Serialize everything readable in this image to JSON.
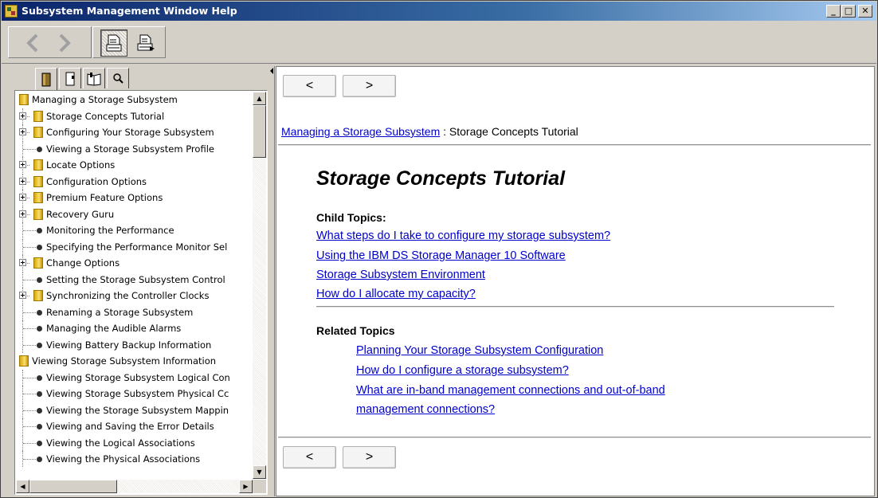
{
  "window": {
    "title": "Subsystem Management Window Help",
    "min_glyph": "_",
    "max_glyph": "□",
    "close_glyph": "✕"
  },
  "toolbar": {
    "back_icon": "back-arrow-icon",
    "forward_icon": "forward-arrow-icon",
    "hide_icon": "hide-pane-icon",
    "print_icon": "print-icon"
  },
  "tabs": [
    {
      "icon": "contents-book-icon"
    },
    {
      "icon": "index-icon"
    },
    {
      "icon": "bookmark-book-icon"
    },
    {
      "icon": "search-magnifier-icon"
    }
  ],
  "tree": [
    {
      "label": "Managing a Storage Subsystem",
      "kind": "folder",
      "level": 0
    },
    {
      "label": "Storage Concepts Tutorial",
      "kind": "folder",
      "level": 1,
      "expander": true
    },
    {
      "label": "Configuring Your Storage Subsystem",
      "kind": "folder",
      "level": 1,
      "expander": true
    },
    {
      "label": "Viewing a Storage Subsystem Profile",
      "kind": "page",
      "level": 1
    },
    {
      "label": "Locate Options",
      "kind": "folder",
      "level": 1,
      "expander": true
    },
    {
      "label": "Configuration Options",
      "kind": "folder",
      "level": 1,
      "expander": true
    },
    {
      "label": "Premium Feature Options",
      "kind": "folder",
      "level": 1,
      "expander": true
    },
    {
      "label": "Recovery Guru",
      "kind": "folder",
      "level": 1,
      "expander": true
    },
    {
      "label": "Monitoring the Performance",
      "kind": "page",
      "level": 1
    },
    {
      "label": "Specifying the Performance Monitor Sel",
      "kind": "page",
      "level": 1
    },
    {
      "label": "Change Options",
      "kind": "folder",
      "level": 1,
      "expander": true
    },
    {
      "label": "Setting the Storage Subsystem Control",
      "kind": "page",
      "level": 1
    },
    {
      "label": "Synchronizing the Controller Clocks",
      "kind": "folder",
      "level": 1,
      "expander": true
    },
    {
      "label": "Renaming a Storage Subsystem",
      "kind": "page",
      "level": 1
    },
    {
      "label": "Managing the Audible Alarms",
      "kind": "page",
      "level": 1
    },
    {
      "label": "Viewing Battery Backup Information",
      "kind": "page",
      "level": 1
    },
    {
      "label": "Viewing Storage Subsystem Information",
      "kind": "folder",
      "level": 0
    },
    {
      "label": "Viewing Storage Subsystem Logical Con",
      "kind": "page",
      "level": 1
    },
    {
      "label": "Viewing Storage Subsystem Physical Cc",
      "kind": "page",
      "level": 1
    },
    {
      "label": "Viewing the Storage Subsystem Mappin",
      "kind": "page",
      "level": 1
    },
    {
      "label": "Viewing and Saving the Error Details",
      "kind": "page",
      "level": 1
    },
    {
      "label": "Viewing the Logical Associations",
      "kind": "page",
      "level": 1
    },
    {
      "label": "Viewing the Physical Associations",
      "kind": "page",
      "level": 1
    }
  ],
  "content": {
    "prev_label": "<",
    "next_label": ">",
    "breadcrumb_link": "Managing a Storage Subsystem",
    "breadcrumb_sep": " : ",
    "breadcrumb_current": "Storage Concepts Tutorial",
    "heading": "Storage Concepts Tutorial",
    "child_topics_label": "Child Topics:",
    "child_topics": [
      "What steps do I take to configure my storage subsystem?",
      "Using the IBM DS Storage Manager 10 Software",
      "Storage Subsystem Environment",
      "How do I allocate my capacity?"
    ],
    "related_topics_label": "Related Topics",
    "related_topics": [
      "Planning Your Storage Subsystem Configuration",
      "How do I configure a storage subsystem?",
      "What are in-band management connections and out-of-band",
      "management connections?"
    ]
  }
}
